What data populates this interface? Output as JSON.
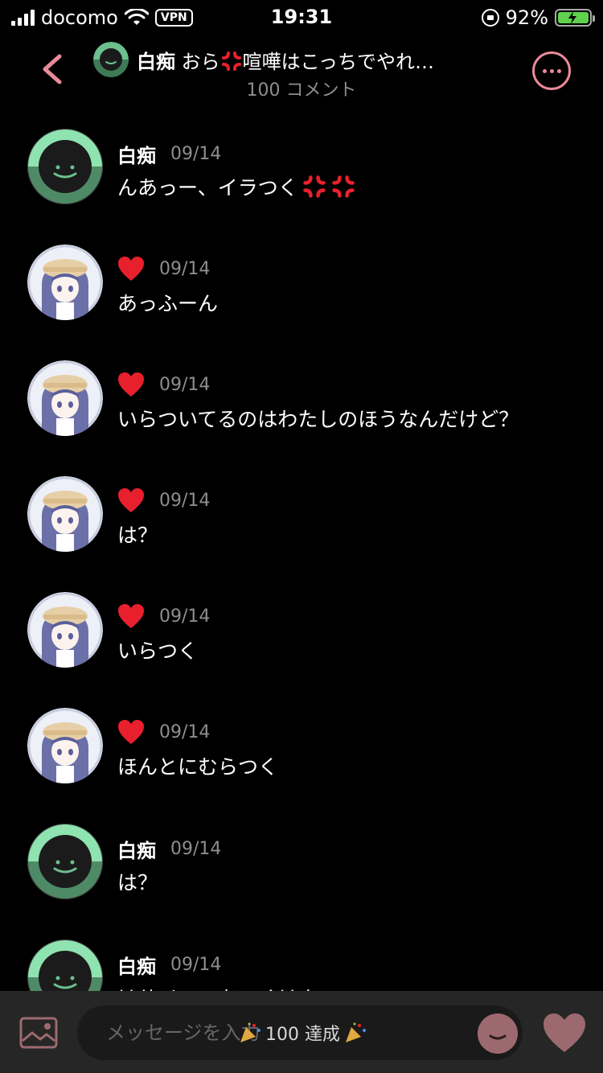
{
  "status_bar": {
    "carrier": "docomo",
    "vpn": "VPN",
    "time": "19:31",
    "battery": "92%"
  },
  "header": {
    "name": "白痴",
    "title_pre": "おら",
    "title_post": "喧嘩はこっちでやれ…",
    "subtitle": "100 コメント"
  },
  "comments": [
    {
      "author_type": "dark",
      "name": "白痴",
      "date": "09/14",
      "text": "んあっー、イラつく",
      "angers": 2
    },
    {
      "author_type": "anime",
      "name": "",
      "date": "09/14",
      "text": "あっふーん"
    },
    {
      "author_type": "anime",
      "name": "",
      "date": "09/14",
      "text": "いらついてるのはわたしのほうなんだけど？"
    },
    {
      "author_type": "anime",
      "name": "",
      "date": "09/14",
      "text": "は？"
    },
    {
      "author_type": "anime",
      "name": "",
      "date": "09/14",
      "text": "いらつく"
    },
    {
      "author_type": "anime",
      "name": "",
      "date": "09/14",
      "text": "ほんとにむらつく"
    },
    {
      "author_type": "dark",
      "name": "白痴",
      "date": "09/14",
      "text": "は？"
    },
    {
      "author_type": "dark",
      "name": "白痴",
      "date": "09/14",
      "text": "はサイコーあつくはよ"
    }
  ],
  "composer": {
    "placeholder": "メッセージを入力",
    "achievement": "100 達成"
  },
  "colors": {
    "accent_pink": "#e88a9a",
    "avatar_green": "#6dbf8f",
    "heart_red": "#e8202e"
  }
}
